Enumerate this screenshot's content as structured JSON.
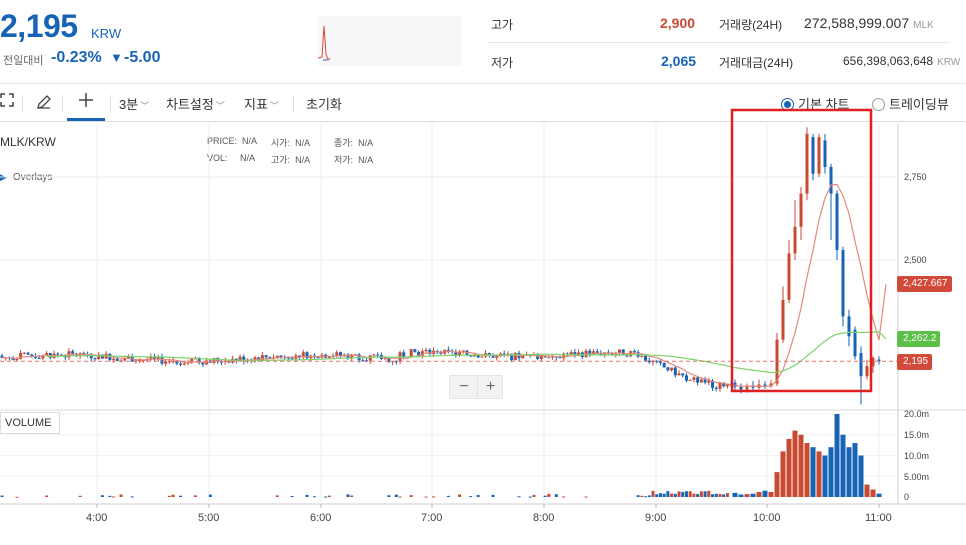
{
  "ticker": {
    "price": "2,195",
    "unit": "KRW",
    "change_label": "전일대비",
    "change_pct": "-0.23%",
    "change_arrow": "▼",
    "change_abs": "-5.00",
    "high_label": "고가",
    "high_value": "2,900",
    "low_label": "저가",
    "low_value": "2,065",
    "volume24_label": "거래량(24H)",
    "volume24_value": "272,588,999.007",
    "volume24_unit": "MLK",
    "amount24_label": "거래대금(24H)",
    "amount24_value": "656,398,063,648",
    "amount24_unit": "KRW"
  },
  "toolbar": {
    "interval": "3분",
    "chart_settings": "차트설정",
    "indicators": "지표",
    "reset": "초기화",
    "basic_chart": "기본 차트",
    "tradingview": "트레이딩뷰"
  },
  "chart": {
    "symbol": "MLK/KRW",
    "overlays": "Overlays",
    "ohlc": {
      "price_label": "PRICE:",
      "price_value": "N/A",
      "open_label": "시가:",
      "open_value": "N/A",
      "close_label": "종가:",
      "close_value": "N/A",
      "vol_label": "VOL:",
      "vol_value": "N/A",
      "high_label": "고가:",
      "high_value": "N/A",
      "low_label": "저가:",
      "low_value": "N/A"
    },
    "zoom_out": "−",
    "zoom_in": "+",
    "volume_label": "VOLUME",
    "tags": {
      "ma_red": "2,427.667",
      "ma_green": "2,262.2",
      "last": "2,195"
    },
    "colors": {
      "up": "#c84a31",
      "down": "#1763b6",
      "ma_short": "#e28a7c",
      "ma_long": "#7dd36a",
      "highlight": "#e02020"
    }
  },
  "chart_data": {
    "type": "candlestick",
    "price_axis": {
      "ticks": [
        "2,750",
        "2,500"
      ],
      "tick_values": [
        2750,
        2500
      ],
      "ylim": [
        2050,
        2900
      ]
    },
    "volume_axis": {
      "ticks": [
        "20.0m",
        "15.0m",
        "10.0m",
        "5.00m",
        "0"
      ],
      "tick_values": [
        20,
        15,
        10,
        5,
        0
      ]
    },
    "x_axis": {
      "ticks": [
        "4:00",
        "5:00",
        "6:00",
        "7:00",
        "8:00",
        "9:00",
        "10:00",
        "11:00"
      ]
    },
    "last_price": 2195
  }
}
